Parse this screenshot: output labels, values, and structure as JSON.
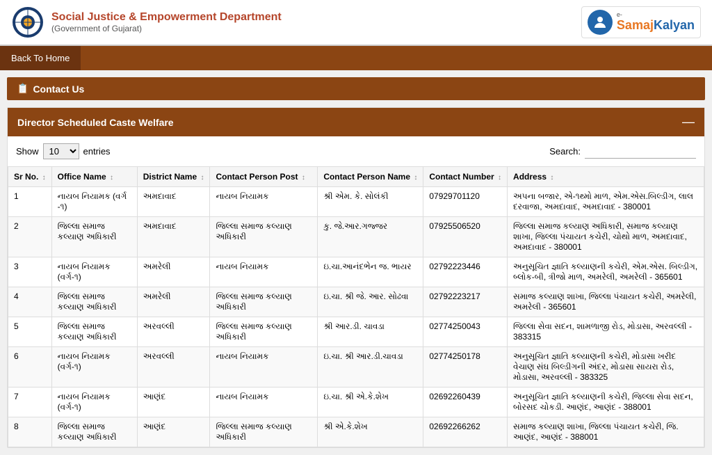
{
  "header": {
    "title": "Social Justice & Empowerment Department",
    "subtitle": "(Government of Gujarat)",
    "logo_alt": "Government Logo",
    "esamaj_label": "e-SamajKalyan"
  },
  "navbar": {
    "back_label": "Back To Home"
  },
  "contact_section": {
    "icon": "📋",
    "label": "Contact Us"
  },
  "table_card": {
    "title": "Director Scheduled Caste Welfare",
    "collapse_icon": "—",
    "entries_label": "Show",
    "entries_value": "10",
    "entries_suffix": "entries",
    "search_label": "Search:"
  },
  "columns": [
    {
      "id": "sr",
      "label": "Sr No.",
      "sortable": true
    },
    {
      "id": "office",
      "label": "Office Name",
      "sortable": true
    },
    {
      "id": "district",
      "label": "District Name",
      "sortable": true
    },
    {
      "id": "post",
      "label": "Contact Person Post",
      "sortable": true
    },
    {
      "id": "name",
      "label": "Contact Person Name",
      "sortable": true
    },
    {
      "id": "number",
      "label": "Contact Number",
      "sortable": true
    },
    {
      "id": "address",
      "label": "Address",
      "sortable": true
    }
  ],
  "rows": [
    {
      "sr": "1",
      "office": "નાયબ નિયામક (વર્ગ -૧)",
      "district": "અમદાવાદ",
      "post": "નાયબ નિયામક",
      "name": "શ્રી એમ. કે. સોલંકી",
      "number": "07929701120",
      "address": "અપના બજાર, એ-૧થ્મો માળ, એમ.એસ.બિલ્ડીગ, લાલ દરવાજા, અમદાવાદ, અમદાવાદ - 380001"
    },
    {
      "sr": "2",
      "office": "જિલ્લા સમાજ કલ્યાણ અધિકારી",
      "district": "અમદાવાદ",
      "post": "જિલ્લા સમાજ કલ્યાણ અધિકારી",
      "name": "કુ. જે.આર.ગજ્જર",
      "number": "07925506520",
      "address": "જિલ્લા સમાજ કલ્યાણ અધિકારી, સમાજ કલ્યાણ શાખા, જિલ્લા પંચાયત કચેરી, ચોથો માળ, અમદાવાદ, અમદાવાદ - 380001"
    },
    {
      "sr": "3",
      "office": "નાયબ નિયામક (વર્ગ-૧)",
      "district": "અમરેલી",
      "post": "નાયબ નિયામક",
      "name": "ઇ.ચા.આનંદભેન જ. ભાયર",
      "number": "02792223446",
      "address": "અનુસૂચિત જ્ઞાતિ કલ્યાણની કચેરી, એમ.એસ. બિલ્ડીગ, બ્લોક-બી, ત્રીજો માળ, અમરેલી, અમરેલી - 365601"
    },
    {
      "sr": "4",
      "office": "જિલ્લા સમાજ કલ્યાણ અધિકારી",
      "district": "અમરેલી",
      "post": "જિલ્લા સમાજ કલ્યાણ અધિકારી",
      "name": "ઇ.ચા. શ્રી જે. આર. સોઢવા",
      "number": "02792223217",
      "address": "સમાજ કલ્યાણ શાખા, જિલ્લા પંચાયત કચેરી, અમરેલી, અમરેલી - 365601"
    },
    {
      "sr": "5",
      "office": "જિલ્લા સમાજ કલ્યાણ અધિકારી",
      "district": "અરવલ્લી",
      "post": "જિલ્લા સમાજ કલ્યાણ અધિકારી",
      "name": "શ્રી આર.ડી. ચાવડા",
      "number": "02774250043",
      "address": "જિલ્લા સેવા સદન, શામળાજી રોડ, મોડાસા, અરવલ્લી - 383315"
    },
    {
      "sr": "6",
      "office": "નાયબ નિયામક (વર્ગ-૧)",
      "district": "અરવલ્લી",
      "post": "નાયબ નિયામક",
      "name": "ઇ.ચા. શ્રી આર.ડી.ચાવડા",
      "number": "02774250178",
      "address": "અનુસૂચિત જ્ઞાતિ કલ્યાણની કચેરી, મોડાસા ખરીદ વેચાણ સંઘ બિલ્ડીગની અંદર, મોડાસા સાયરા રોડ, મોડાસા, અરવલ્લી - 383325"
    },
    {
      "sr": "7",
      "office": "નાયબ નિયામક (વર્ગ-૧)",
      "district": "આણંદ",
      "post": "નાયબ નિયામક",
      "name": "ઇ.ચા. શ્રી એ.કે.શેખ",
      "number": "02692260439",
      "address": "અનુસૂચિત જ્ઞાતિ કલ્યાણની કચેરી, જિલ્લા સેવા સદન, બોરસદ ચોકડી. આણંદ, આણંદ - 388001"
    },
    {
      "sr": "8",
      "office": "જિલ્લા સમાજ કલ્યાણ અધિકારી",
      "district": "આણંદ",
      "post": "જિલ્લા સમાજ કલ્યાણ અધિકારી",
      "name": "શ્રી એ.કે.શેખ",
      "number": "02692266262",
      "address": "સમાજ કલ્યાણ શાખા, જિલ્લા પંચાયત કચેરી, જિ. આણંદ, આણંદ - 388001"
    }
  ]
}
